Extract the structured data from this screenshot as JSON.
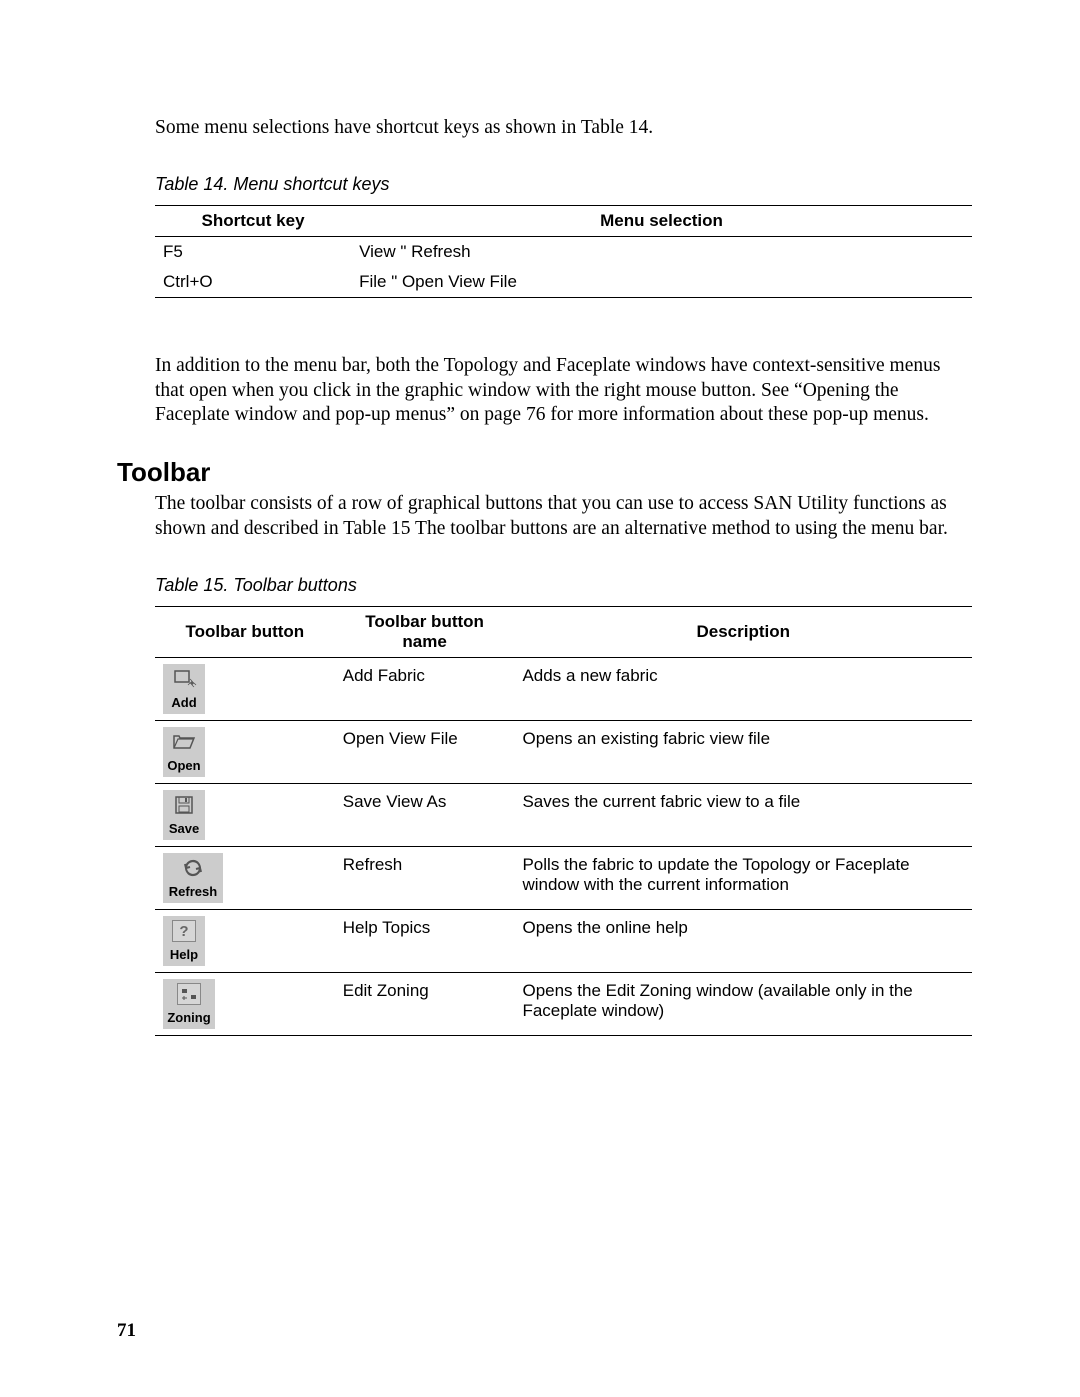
{
  "intro_text": "Some menu selections have shortcut keys as shown in Table 14.",
  "table14": {
    "caption": "Table 14. Menu shortcut keys",
    "headers": [
      "Shortcut key",
      "Menu selection"
    ],
    "rows": [
      [
        "F5",
        "View \" Refresh"
      ],
      [
        "Ctrl+O",
        "File \" Open View File"
      ]
    ]
  },
  "context_para": "In addition to the menu bar, both the Topology and Faceplate windows have context-sensitive menus that open when you click in the graphic window with the right mouse button. See “Opening the Faceplate window and pop-up menus” on page 76 for more information about these pop-up menus.",
  "toolbar_heading": "Toolbar",
  "toolbar_para": "The toolbar consists of a row of graphical buttons that you can use to access SAN Utility functions as shown and described in Table 15 The toolbar buttons are an alternative method to using the menu bar.",
  "table15": {
    "caption": "Table 15. Toolbar buttons",
    "headers": [
      "Toolbar button",
      "Toolbar button name",
      "Description"
    ],
    "rows": [
      {
        "icon_label": "Add",
        "name": "Add Fabric",
        "desc": "Adds a new fabric"
      },
      {
        "icon_label": "Open",
        "name": "Open View File",
        "desc": "Opens an existing fabric view file"
      },
      {
        "icon_label": "Save",
        "name": "Save View As",
        "desc": "Saves the current fabric view to a file"
      },
      {
        "icon_label": "Refresh",
        "name": "Refresh",
        "desc": "Polls the fabric to update the Topology or Faceplate window with the current information"
      },
      {
        "icon_label": "Help",
        "name": "Help Topics",
        "desc": "Opens the online help"
      },
      {
        "icon_label": "Zoning",
        "name": "Edit Zoning",
        "desc": "Opens the Edit Zoning window (available only in the Faceplate window)"
      }
    ]
  },
  "page_number": "71"
}
